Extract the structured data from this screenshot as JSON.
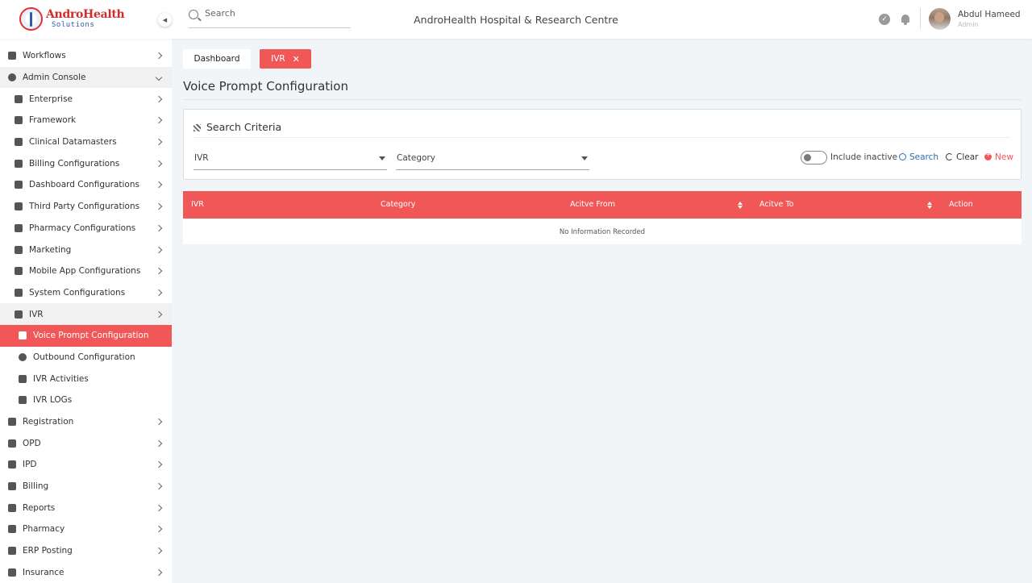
{
  "header": {
    "logo_name": "AndroHealth",
    "logo_sub": "Solutions",
    "search_placeholder": "Search",
    "hospital_title": "AndroHealth Hospital & Research Centre",
    "user_name": "Abdul Hameed",
    "user_role": "Admin"
  },
  "sidebar": {
    "items": [
      {
        "label": "Workflows",
        "icon": "laptop-icon"
      },
      {
        "label": "Admin Console",
        "icon": "gear-icon"
      },
      {
        "label": "Enterprise",
        "icon": "bank-icon"
      },
      {
        "label": "Framework",
        "icon": "server-icon"
      },
      {
        "label": "Clinical Datamasters",
        "icon": "home-icon"
      },
      {
        "label": "Billing Configurations",
        "icon": "card-icon"
      },
      {
        "label": "Dashboard Configurations",
        "icon": "dashboard-icon"
      },
      {
        "label": "Third Party Configurations",
        "icon": "plug-icon"
      },
      {
        "label": "Pharmacy Configurations",
        "icon": "medkit-icon"
      },
      {
        "label": "Marketing",
        "icon": "megaphone-icon"
      },
      {
        "label": "Mobile App Configurations",
        "icon": "mobile-icon"
      },
      {
        "label": "System Configurations",
        "icon": "system-icon"
      },
      {
        "label": "IVR",
        "icon": "hand-pointer-icon"
      },
      {
        "label": "Voice Prompt Configuration",
        "icon": "document-icon"
      },
      {
        "label": "Outbound Configuration",
        "icon": "circle-dot-icon"
      },
      {
        "label": "IVR Activities",
        "icon": "activity-icon"
      },
      {
        "label": "IVR LOGs",
        "icon": "list-icon"
      },
      {
        "label": "Registration",
        "icon": "checkbox-icon"
      },
      {
        "label": "OPD",
        "icon": "building-icon"
      },
      {
        "label": "IPD",
        "icon": "bed-icon"
      },
      {
        "label": "Billing",
        "icon": "wallet-icon"
      },
      {
        "label": "Reports",
        "icon": "report-icon"
      },
      {
        "label": "Pharmacy",
        "icon": "pharmacy-icon"
      },
      {
        "label": "ERP Posting",
        "icon": "monitor-icon"
      },
      {
        "label": "Insurance",
        "icon": "family-icon"
      }
    ]
  },
  "tabs": {
    "dashboard": "Dashboard",
    "ivr": "IVR",
    "close_glyph": "✕"
  },
  "page": {
    "title": "Voice Prompt Configuration"
  },
  "criteria": {
    "title": "Search Criteria",
    "ivr_dropdown": "IVR",
    "category_dropdown": "Category",
    "include_inactive": "Include inactive",
    "search": "Search",
    "clear": "Clear",
    "new": "New"
  },
  "table": {
    "columns": [
      "IVR",
      "Category",
      "Acitve From",
      "Acitve To",
      "Action"
    ],
    "empty_text": "No Information Recorded"
  },
  "colors": {
    "accent": "#f25757",
    "link": "#2b6fb0",
    "background": "#f2f5f8"
  }
}
